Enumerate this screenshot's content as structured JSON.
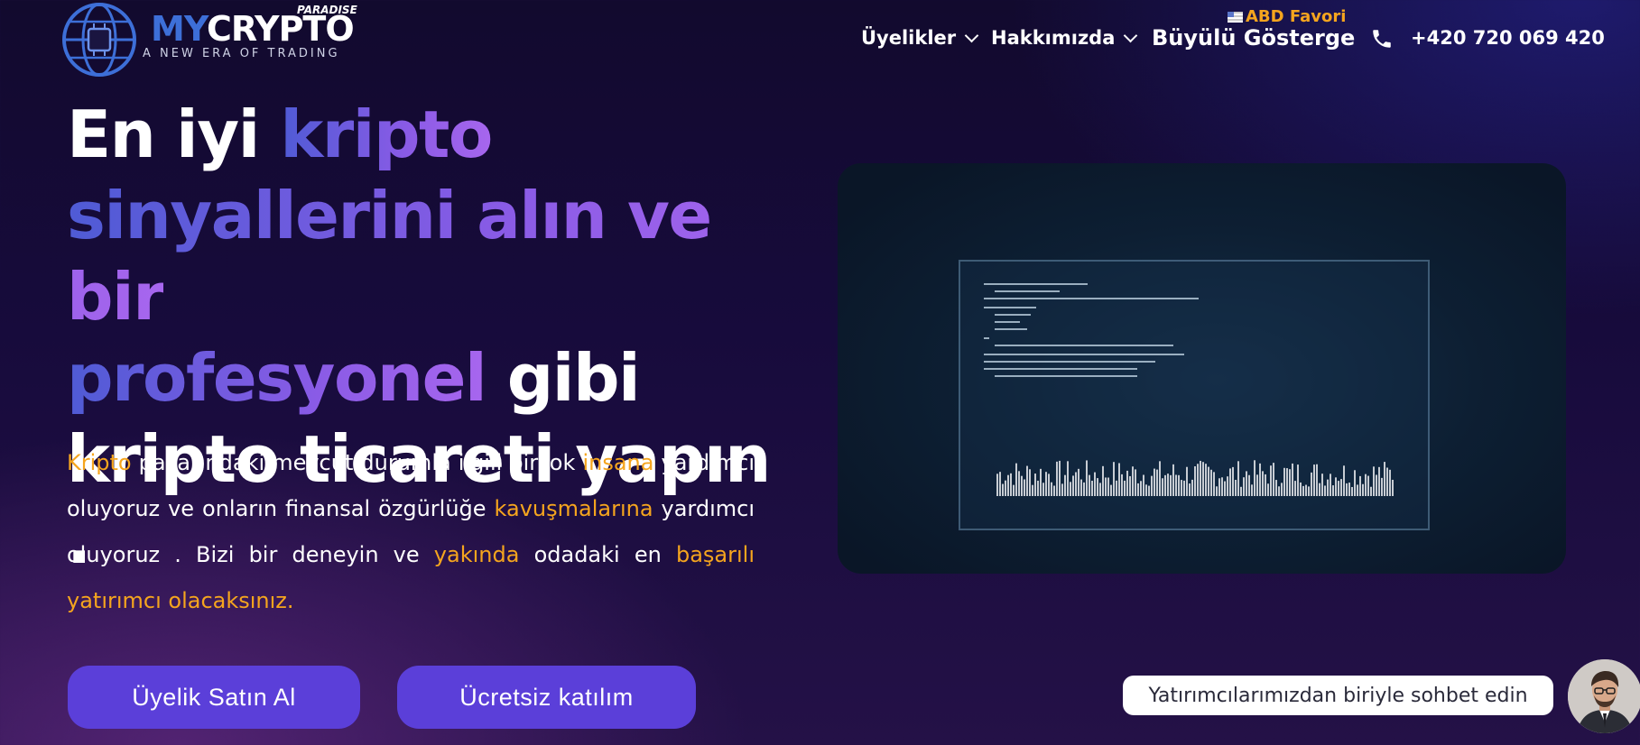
{
  "brand": {
    "name_part1": "MY",
    "name_part2": "CRYPTO",
    "paradise": "PARADISE",
    "tagline": "A NEW ERA OF TRADING"
  },
  "nav": {
    "items": [
      {
        "label": "Üyelikler"
      },
      {
        "label": "Hakkımızda"
      }
    ],
    "indicator": "Büyülü Gösterge",
    "favorite_badge": "ABD Favori",
    "phone": "+420 720 069 420"
  },
  "hero": {
    "headline": {
      "l1_white": "En iyi ",
      "l1_grad": "kripto",
      "l2_grad": "sinyallerini alın ve bir",
      "l3_grad": "profesyonel",
      "l3_white": " gibi",
      "l4_white": "kripto ticareti yapın ."
    },
    "paragraph": {
      "p1_hl": "Kripto",
      "p2": " pazarındaki mevcut durumla ilgili birçok ",
      "p3_hl": "insana",
      "p4": " yardımcı oluyoruz ve onların finansal özgürlüğe ",
      "p5_hl": "kavuşmalarına",
      "p6": " yardımcı oluyoruz . Bizi bir deneyin ve ",
      "p7_hl": "yakında",
      "p8": " odadaki en ",
      "p9_hl": "başarılı yatırımcı olacaksınız."
    },
    "buttons": {
      "buy": "Üyelik Satın Al",
      "free": "Ücretsiz katılım"
    }
  },
  "chat": {
    "prompt": "Yatırımcılarımızdan biriyle sohbet edin"
  },
  "colors": {
    "accent_orange": "#f5a51e",
    "button_purple": "#5b3fd9",
    "brand_blue": "#3d6fd8"
  }
}
